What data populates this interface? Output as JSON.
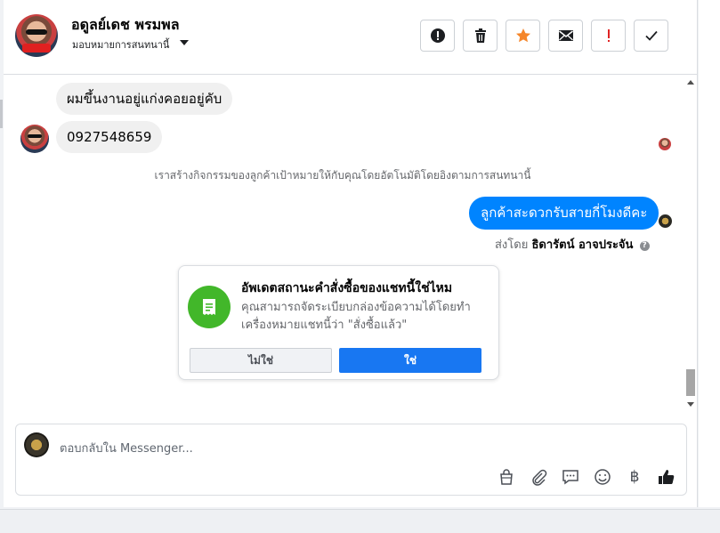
{
  "header": {
    "contact_name": "อดูลย์เดช พรมพล",
    "assign_label": "มอบหมายการสนทนานี้",
    "actions": [
      {
        "name": "report-icon"
      },
      {
        "name": "trash-icon"
      },
      {
        "name": "star-icon",
        "color": "#f5862a"
      },
      {
        "name": "envelope-icon"
      },
      {
        "name": "exclamation-icon",
        "color": "#e02424"
      },
      {
        "name": "check-icon"
      }
    ]
  },
  "messages": {
    "incoming_1": "ผมขึ้นงานอยู่แก่งคอยอยู่คับ",
    "incoming_2": "0927548659",
    "system_note": "เราสร้างกิจกรรมของลูกค้าเป้าหมายให้กับคุณโดยอัตโนมัติโดยอิงตามการสนทนานี้",
    "outgoing_1": "ลูกค้าสะดวกรับสายกี่โมงดีคะ",
    "sent_by_prefix": "ส่งโดย",
    "sent_by_name": "ธิดารัตน์ อาจประจัน"
  },
  "order_card": {
    "title": "อัพเดตสถานะคำสั่งซื้อของแชทนี้ใช่ไหม",
    "description_line1": "คุณสามารถจัดระเบียบกล่องข้อความได้โดยทำ",
    "description_line2": "เครื่องหมายแชทนี้ว่า \"สั่งซื้อแล้ว\"",
    "no_label": "ไม่ใช่",
    "yes_label": "ใช่"
  },
  "composer": {
    "placeholder": "ตอบกลับใน Messenger...",
    "tools": [
      "shopping-bag-icon",
      "paperclip-icon",
      "saved-reply-icon",
      "emoji-icon",
      "baht-icon",
      "thumbs-up-icon"
    ],
    "baht_symbol": "฿"
  },
  "colors": {
    "messenger_blue": "#0084ff",
    "button_blue": "#1877f2",
    "card_green": "#42b72a"
  }
}
